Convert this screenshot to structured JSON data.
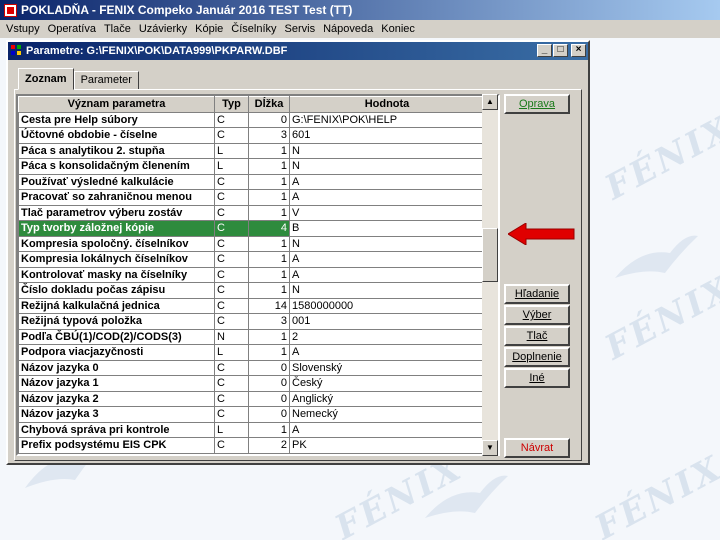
{
  "app": {
    "title": "POKLADŇA - FENIX Compeko  Január 2016  TEST Test  (TT)"
  },
  "menu": [
    "Vstupy",
    "Operatíva",
    "Tlače",
    "Uzávierky",
    "Kópie",
    "Číselníky",
    "Servis",
    "Nápoveda",
    "Koniec"
  ],
  "window": {
    "title": "Parametre: G:\\FENIX\\POK\\DATA999\\PKPARW.DBF",
    "min_label": "_",
    "max_label": "□",
    "close_label": "×"
  },
  "tabs": [
    {
      "label": "Zoznam",
      "active": true
    },
    {
      "label": "Parameter",
      "active": false
    }
  ],
  "table": {
    "headers": [
      "Význam parametra",
      "Typ",
      "Dĺžka",
      "Hodnota"
    ],
    "selected_index": 7,
    "rows": [
      [
        "Cesta pre Help súbory",
        "C",
        "0",
        "G:\\FENIX\\POK\\HELP"
      ],
      [
        "Účtovné obdobie - číselne",
        "C",
        "3",
        "601"
      ],
      [
        "Páca s analytikou 2. stupňa",
        "L",
        "1",
        "N"
      ],
      [
        "Páca s konsolidačným členením",
        "L",
        "1",
        "N"
      ],
      [
        "Používať výsledné kalkulácie",
        "C",
        "1",
        "A"
      ],
      [
        "Pracovať so zahraničnou menou",
        "C",
        "1",
        "A"
      ],
      [
        "Tlač parametrov výberu zostáv",
        "C",
        "1",
        "V"
      ],
      [
        "Typ tvorby záložnej kópie",
        "C",
        "4",
        "B"
      ],
      [
        "Kompresia spoločný. číselníkov",
        "C",
        "1",
        "N"
      ],
      [
        "Kompresia lokálnych číselníkov",
        "C",
        "1",
        "A"
      ],
      [
        "Kontrolovať masky na číselníky",
        "C",
        "1",
        "A"
      ],
      [
        "Číslo dokladu počas zápisu",
        "C",
        "1",
        "N"
      ],
      [
        "Režijná kalkulačná jednica",
        "C",
        "14",
        "1580000000"
      ],
      [
        "Režijná typová položka",
        "C",
        "3",
        "001"
      ],
      [
        "Podľa ČBÚ(1)/COD(2)/CODS(3)",
        "N",
        "1",
        "2"
      ],
      [
        "Podpora viacjazyčnosti",
        "L",
        "1",
        "A"
      ],
      [
        "Názov jazyka 0",
        "C",
        "0",
        "Slovenský"
      ],
      [
        "Názov jazyka 1",
        "C",
        "0",
        "Český"
      ],
      [
        "Názov jazyka 2",
        "C",
        "0",
        "Anglický"
      ],
      [
        "Názov jazyka 3",
        "C",
        "0",
        "Nemecký"
      ],
      [
        "Chybová správa  pri kontrole",
        "L",
        "1",
        "A"
      ],
      [
        "Prefix podsystému EIS CPK",
        "C",
        "2",
        "PK"
      ]
    ]
  },
  "buttons": {
    "oprava": "Oprava",
    "hladanie": "Hľadanie",
    "vyber": "Výber",
    "tlac": "Tlač",
    "doplnenie": "Doplnenie",
    "ine": "Iné",
    "navrat": "Návrat"
  },
  "watermark": "FÉNIX",
  "colors": {
    "selected_row": "#2e8b3d",
    "arrow": "#e00000",
    "accent_green": "#1a7a1a",
    "title_blue": "#0a246a"
  }
}
